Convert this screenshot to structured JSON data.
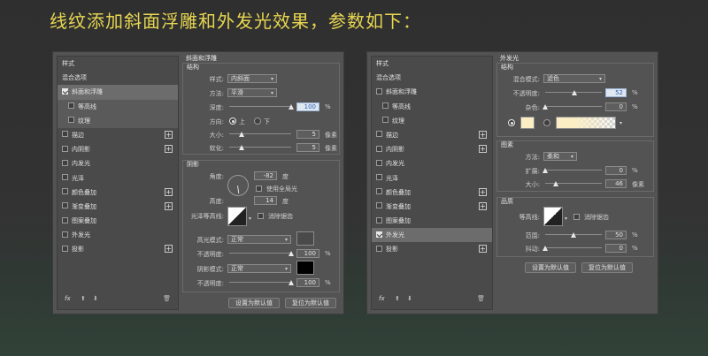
{
  "heading": "线纹添加斜面浮雕和外发光效果，参数如下：",
  "sidebar_items": [
    "样式",
    "混合选项",
    "斜面和浮雕",
    "等高线",
    "纹理",
    "描边",
    "内阴影",
    "内发光",
    "光泽",
    "颜色叠加",
    "渐变叠加",
    "图案叠加",
    "外发光",
    "投影"
  ],
  "footer": {
    "fx": "fx"
  },
  "left": {
    "section_title": "斜面和浮雕",
    "structure": {
      "title": "结构",
      "style_label": "样式:",
      "style_value": "内斜面",
      "technique_label": "方法:",
      "technique_value": "平滑",
      "depth_label": "深度:",
      "depth_value": "100",
      "depth_unit": "%",
      "depth_level": 1.0,
      "direction_label": "方向:",
      "direction_up": "上",
      "direction_down": "下",
      "size_label": "大小:",
      "size_value": "5",
      "size_unit": "像素",
      "size_level": 0.2,
      "soften_label": "软化:",
      "soften_value": "5",
      "soften_unit": "像素",
      "soften_level": 0.2
    },
    "shading": {
      "title": "阴影",
      "angle_label": "角度:",
      "angle_value": "-82",
      "angle_unit": "度",
      "global_light": "使用全局光",
      "altitude_label": "高度:",
      "altitude_value": "14",
      "altitude_unit": "度",
      "gloss_label": "光泽等高线:",
      "antialias": "消除锯齿",
      "highlight_label": "高光模式:",
      "highlight_value": "正常",
      "highlight_color": "#4a4a4a",
      "hl_opacity_label": "不透明度:",
      "hl_opacity_value": "100",
      "hl_opacity_unit": "%",
      "hl_opacity_level": 1.0,
      "shadow_label": "阴影模式:",
      "shadow_value": "正常",
      "shadow_color": "#000000",
      "sh_opacity_label": "不透明度:",
      "sh_opacity_value": "100",
      "sh_opacity_unit": "%",
      "sh_opacity_level": 1.0
    },
    "btn_default": "设置为默认值",
    "btn_reset": "复位为默认值"
  },
  "right": {
    "section_title": "外发光",
    "structure": {
      "title": "结构",
      "blend_label": "混合模式:",
      "blend_value": "滤色",
      "opacity_label": "不透明度:",
      "opacity_value": "52",
      "opacity_unit": "%",
      "opacity_level": 0.52,
      "noise_label": "杂色:",
      "noise_value": "0",
      "noise_unit": "%",
      "noise_level": 0.0,
      "glow_color": "#fbeec5"
    },
    "elements": {
      "title": "图素",
      "technique_label": "方法:",
      "technique_value": "柔和",
      "spread_label": "扩展:",
      "spread_value": "0",
      "spread_unit": "%",
      "spread_level": 0.0,
      "size_label": "大小:",
      "size_value": "46",
      "size_unit": "像素",
      "size_level": 0.19
    },
    "quality": {
      "title": "品质",
      "contour_label": "等高线:",
      "antialias": "消除锯齿",
      "range_label": "范围:",
      "range_value": "50",
      "range_unit": "%",
      "range_level": 0.5,
      "jitter_label": "抖动:",
      "jitter_value": "0",
      "jitter_unit": "%",
      "jitter_level": 0.0
    },
    "btn_default": "设置为默认值",
    "btn_reset": "复位为默认值"
  }
}
